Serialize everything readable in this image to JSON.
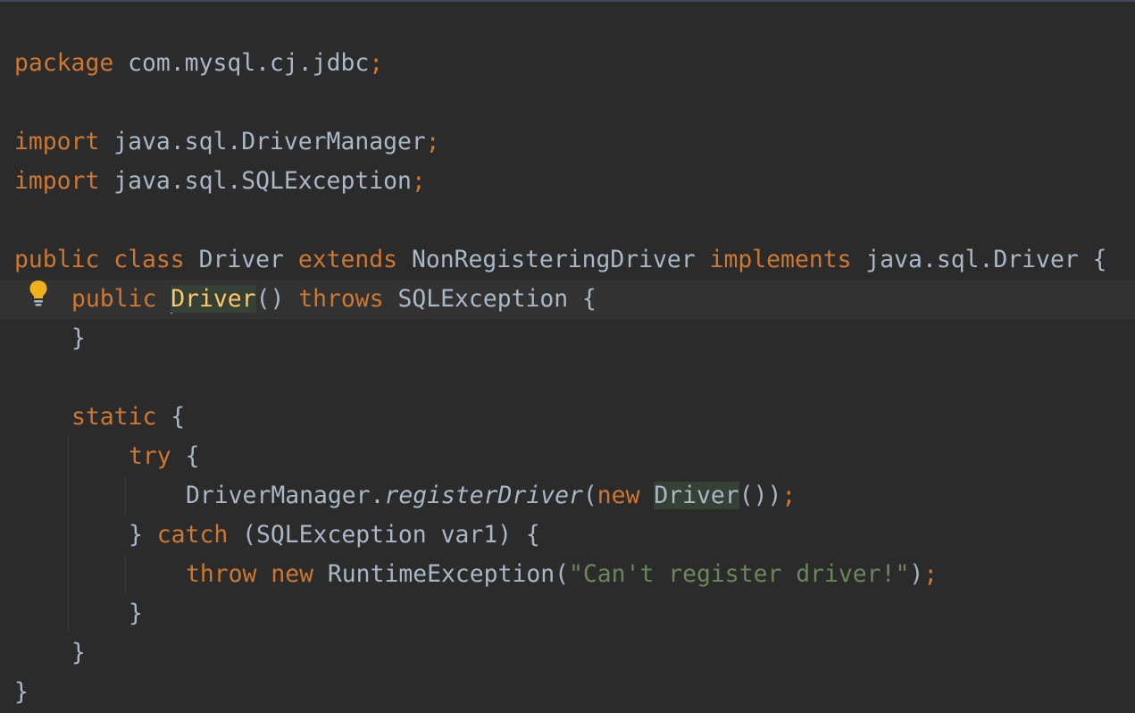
{
  "editor": {
    "package_line": {
      "kw": "package",
      "name": "com.mysql.cj.jdbc",
      "semi": ";"
    },
    "imports": [
      {
        "kw": "import",
        "name": "java.sql.DriverManager",
        "semi": ";"
      },
      {
        "kw": "import",
        "name": "java.sql.SQLException",
        "semi": ";"
      }
    ],
    "class_decl": {
      "public": "public",
      "class": "class",
      "name": "Driver",
      "extends": "extends",
      "parent": "NonRegisteringDriver",
      "implements": "implements",
      "iface": "java.sql.Driver",
      "brace": "{"
    },
    "ctor": {
      "public": "public",
      "name": "Driver",
      "parens": "()",
      "throws": "throws",
      "exc": "SQLException",
      "brace": "{",
      "close": "}"
    },
    "static_block": {
      "static": "static",
      "brace": "{",
      "try": "try",
      "try_brace": "{",
      "call_obj": "DriverManager.",
      "call_method": "registerDriver",
      "call_open": "(",
      "new": "new",
      "new_type": "Driver",
      "call_close": "())",
      "semi": ";",
      "catch_close": "}",
      "catch": "catch",
      "catch_param": "(SQLException var1)",
      "catch_brace": "{",
      "throw": "throw",
      "throw_new": "new",
      "throw_type": "RuntimeException(",
      "throw_msg": "\"Can't register driver!\"",
      "throw_end": ")",
      "throw_semi": ";",
      "inner_close": "}",
      "static_close": "}"
    },
    "class_close": "}",
    "colors": {
      "background": "#2b2b2b",
      "keyword": "#cc7832",
      "text": "#a9b7c6",
      "string": "#6a8759",
      "method_decl": "#ffc66d",
      "current_line": "#323232"
    },
    "gutter_icon": "lightbulb-icon"
  }
}
